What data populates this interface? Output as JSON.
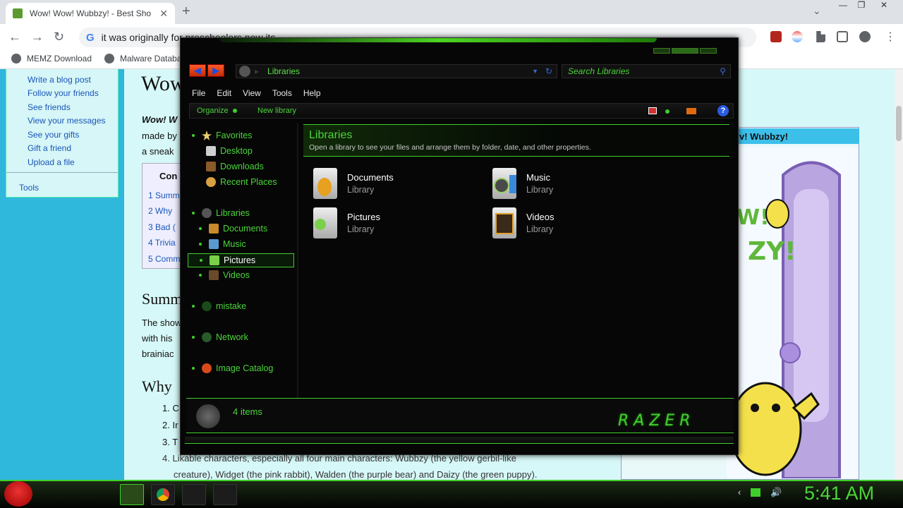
{
  "browser": {
    "tab_title": "Wow! Wow! Wubbzy! - Best Sho",
    "new_tab": "+",
    "close_tab": "✕",
    "win_min": "—",
    "win_max": "❐",
    "win_close": "✕",
    "omnibox": "it was originally for preschoolers now its",
    "bookmarks": [
      "MEMZ Download",
      "Malware Databa"
    ]
  },
  "webpage": {
    "title": "Wow",
    "sidebar_links": [
      "Write a blog post",
      "Follow your friends",
      "See friends",
      "View your messages",
      "See your gifts",
      "Gift a friend",
      "Upload a file"
    ],
    "sidebar_tools": "Tools",
    "intro_bold": "Wow! W",
    "intro_lines": [
      "made by",
      "a sneak"
    ],
    "toc_title": "Con",
    "toc_items": [
      "1  Summ",
      "2  Why",
      "3  Bad (",
      "4  Trivia",
      "5  Comm"
    ],
    "section_summary": "Summ",
    "summary_lines": [
      "The show",
      "with his",
      "brainiac"
    ],
    "section_why": "Why",
    "list_items": [
      "1.  C",
      "2.  Ir",
      "3.  T"
    ],
    "list_item4_line1": "4.  Likable characters, especially all four main characters: Wubbzy (the yellow gerbil-like",
    "list_item4_line2": "creature), Widget (the pink rabbit), Walden (the purple bear) and Daizy (the green puppy).",
    "infobox_header": "v! Wubbzy!"
  },
  "explorer": {
    "address": "Libraries",
    "search_placeholder": "Search Libraries",
    "menu": [
      "File",
      "Edit",
      "View",
      "Tools",
      "Help"
    ],
    "commands": {
      "organize": "Organize",
      "new_library": "New library",
      "help": "?"
    },
    "nav": {
      "favorites": "Favorites",
      "desktop": "Desktop",
      "downloads": "Downloads",
      "recent": "Recent Places",
      "libraries": "Libraries",
      "documents": "Documents",
      "music": "Music",
      "pictures": "Pictures",
      "videos": "Videos",
      "mistake": "mistake",
      "network": "Network",
      "image_catalog": "Image Catalog"
    },
    "header": {
      "title": "Libraries",
      "description": "Open a library to see your files and arrange them by folder, date, and other properties."
    },
    "libraries": [
      {
        "name": "Documents",
        "type": "Library"
      },
      {
        "name": "Music",
        "type": "Library"
      },
      {
        "name": "Pictures",
        "type": "Library"
      },
      {
        "name": "Videos",
        "type": "Library"
      }
    ],
    "item_count": "4 items",
    "brand": "RAZER"
  },
  "taskbar": {
    "clock": "5:41 AM"
  },
  "colors": {
    "accent": "#4bd43a",
    "window_bg": "#060606",
    "page_bg": "#d7f8f8"
  }
}
